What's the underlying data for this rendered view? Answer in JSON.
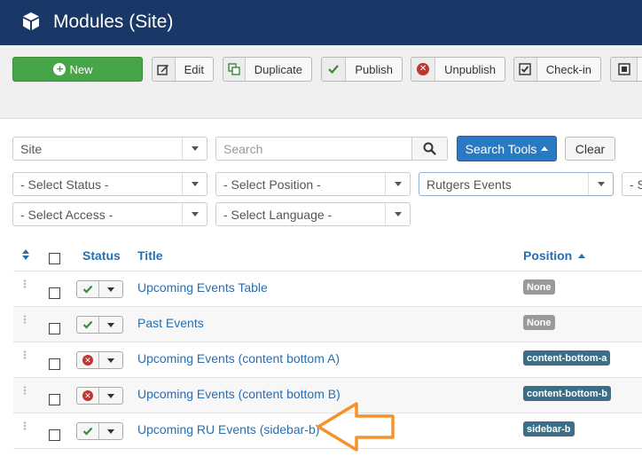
{
  "header": {
    "title": "Modules (Site)",
    "icon": "cube-icon"
  },
  "toolbar": {
    "new": "New",
    "edit": "Edit",
    "duplicate": "Duplicate",
    "publish": "Publish",
    "unpublish": "Unpublish",
    "checkin": "Check-in"
  },
  "filters": {
    "client": "Site",
    "search_placeholder": "Search",
    "search_tools": "Search Tools",
    "clear": "Clear",
    "status": "- Select Status -",
    "position": "- Select Position -",
    "module": "Rutgers Events",
    "partial": "- S",
    "access": "- Select Access -",
    "language": "- Select Language -"
  },
  "table": {
    "headers": {
      "status": "Status",
      "title": "Title",
      "position": "Position"
    },
    "rows": [
      {
        "title": "Upcoming Events Table",
        "status": "published",
        "position": "None"
      },
      {
        "title": "Past Events",
        "status": "published",
        "position": "None"
      },
      {
        "title": "Upcoming Events (content bottom A)",
        "status": "unpublished",
        "position": "content-bottom-a"
      },
      {
        "title": "Upcoming Events (content bottom B)",
        "status": "unpublished",
        "position": "content-bottom-b"
      },
      {
        "title": "Upcoming RU Events (sidebar-b)",
        "status": "published",
        "position": "sidebar-b"
      }
    ]
  },
  "colors": {
    "header": "#1a3867",
    "accent": "#2a7ac3",
    "new": "#46a546",
    "annotation": "#f5922b"
  }
}
